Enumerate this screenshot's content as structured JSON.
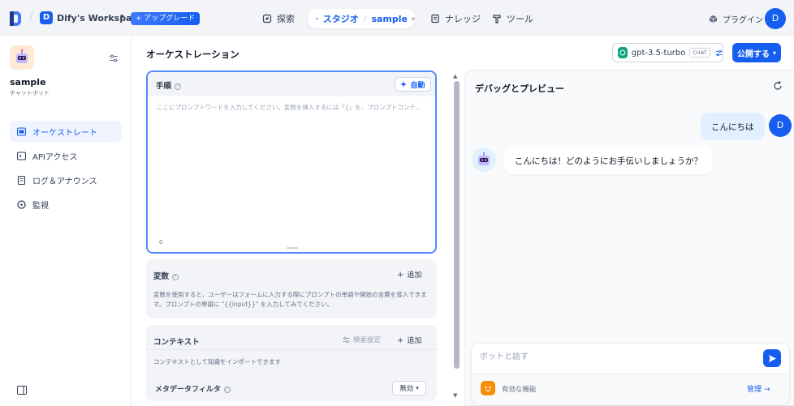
{
  "colors": {
    "accent": "#155eef",
    "background": "#f2f4f7",
    "active_nav_bg": "#eff4ff",
    "focus_border": "#528bff",
    "features_icon": "#f79009",
    "model_logo": "#10a37f"
  },
  "topbar": {
    "logo_icon": "dify-logo-icon",
    "workspace_initial": "D",
    "workspace_name": "Dify's Workspace",
    "workspace_chevron": "▾",
    "upgrade_label": "+ アップグレード",
    "nav": {
      "explore": {
        "label": "探索",
        "icon": "explore-icon"
      },
      "studio": {
        "label": "スタジオ",
        "icon": "robot-icon",
        "app": "sample",
        "chevron": "▾"
      },
      "knowledge": {
        "label": "ナレッジ",
        "icon": "book-icon"
      },
      "tools": {
        "label": "ツール",
        "icon": "hammer-icon"
      }
    },
    "plugins_label": "プラグイン",
    "plugins_icon": "cube-icon",
    "user_initial": "D"
  },
  "sidebar": {
    "app_icon": "robot-app-icon",
    "app_name": "sample",
    "app_type": "チャットボット",
    "items": [
      {
        "label": "オーケストレート",
        "icon": "terminal-window-icon",
        "active": true
      },
      {
        "label": "APIアクセス",
        "icon": "api-terminal-icon",
        "active": false
      },
      {
        "label": "ログ＆アナウンス",
        "icon": "file-list-icon",
        "active": false
      },
      {
        "label": "監視",
        "icon": "gauge-icon",
        "active": false
      }
    ]
  },
  "main": {
    "title": "オーケストレーション",
    "model": {
      "name": "gpt-3.5-turbo",
      "mode_badge": "CHAT"
    },
    "publish": {
      "label": "公開する",
      "chevron": "▾"
    },
    "prompt": {
      "label": "手順",
      "help_glyph": "?",
      "auto_label": "自動",
      "placeholder": "ここにプロンプトワードを入力してください。変数を挿入するには「{」を、プロンプトコンテ...",
      "char_count": "0"
    },
    "variables": {
      "label": "変数",
      "add_label": "追加",
      "description": "変数を使用すると、ユーザーはフォームに入力する際にプロンプトの単語や開始の言葉を導入できます。プロンプトの単語に \"{{input}}\" を入力してみてください。"
    },
    "context": {
      "label": "コンテキスト",
      "search_settings_label": "検索設定",
      "add_label": "追加",
      "description": "コンテキストとして知識をインポートできます",
      "metadata_filter_label": "メタデータフィルタ",
      "metadata_filter_value": "無効"
    },
    "scroll": {
      "up": "▲",
      "down": "▼"
    }
  },
  "debug": {
    "title": "デバッグとプレビュー",
    "messages": [
      {
        "role": "user",
        "text": "こんにちは",
        "avatar_initial": "D"
      },
      {
        "role": "bot",
        "text": "こんにちは！どのようにお手伝いしましょうか？"
      }
    ],
    "input_placeholder": "ボットと話す",
    "features_label": "有効な機能",
    "manage_label": "管理",
    "manage_arrow": "→"
  }
}
